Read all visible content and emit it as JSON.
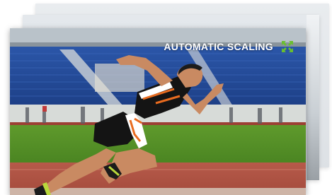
{
  "slider": {
    "caption": "AUTOMATIC SCALING",
    "expand_icon": "expand-arrows-icon",
    "accent_color": "#6abf2e",
    "photo_subject": "sprinter-starting-on-running-track-icon"
  }
}
